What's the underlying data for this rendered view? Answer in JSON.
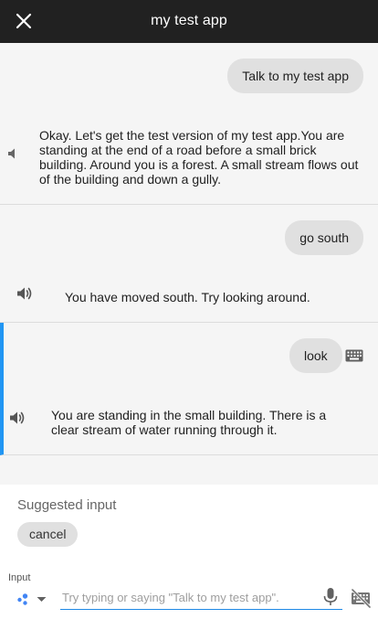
{
  "header": {
    "title": "my test app",
    "close_icon": "close-icon"
  },
  "turns": [
    {
      "user": "Talk to my test app",
      "reply": "Okay. Let's get the test version of my test app.You are standing at the end of a road before a small brick building. Around you is a forest. A small stream flows out of the building and down a gully."
    },
    {
      "user": "go south",
      "reply": "You have moved south. Try looking around."
    },
    {
      "user": "look",
      "reply": "You are standing in the small building. There is a clear stream of water running through it."
    }
  ],
  "suggestions": {
    "label": "Suggested input",
    "chips": [
      "cancel"
    ]
  },
  "input": {
    "label": "Input",
    "placeholder": "Try typing or saying \"Talk to my test app\"."
  },
  "colors": {
    "header_bg": "#212121",
    "accent": "#2196f3",
    "bubble": "#e0e0e0"
  }
}
